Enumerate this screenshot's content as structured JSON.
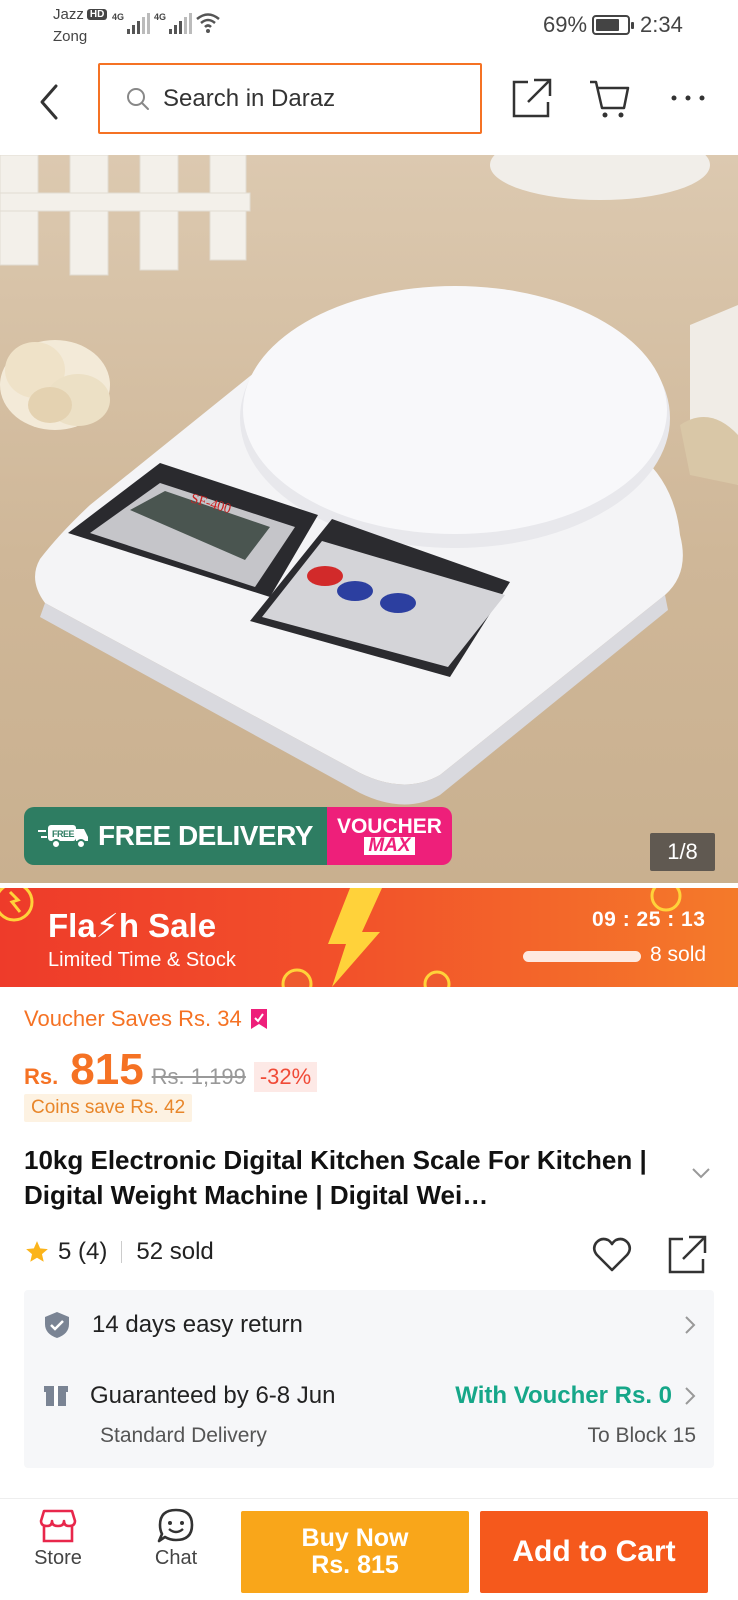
{
  "status_bar": {
    "carrier_primary": "Jazz",
    "hd_badge": "HD",
    "carrier_secondary": "Zong",
    "signal_label": "4G",
    "battery_percent": "69%",
    "battery_level": 0.69,
    "time": "2:34"
  },
  "header": {
    "back_icon": "chevron-left-icon",
    "search_placeholder": "Search in Daraz",
    "share_icon": "share-icon",
    "cart_icon": "cart-icon",
    "more_icon": "more-horizontal-icon"
  },
  "gallery": {
    "promo_free_badge": "FREE",
    "promo_free_delivery": "FREE DELIVERY",
    "promo_voucher": "VOUCHER",
    "promo_max": "MAX",
    "scale_model_label": "SF-400",
    "image_counter": "1/8"
  },
  "flash_sale": {
    "title": "Fla⚡h Sale",
    "subtitle": "Limited Time & Stock",
    "countdown": "09 : 25 : 13",
    "sold_text": "8 sold"
  },
  "pricing": {
    "voucher_saves": "Voucher Saves Rs. 34",
    "currency": "Rs.",
    "price": "815",
    "original_price": "Rs. 1,199",
    "discount": "-32%",
    "coins_save": "Coins save Rs. 42"
  },
  "product": {
    "title": "10kg Electronic Digital Kitchen Scale For Kitchen | Digital Weight Machine | Digital Wei…",
    "rating": "5 (4)",
    "sold": "52 sold"
  },
  "service": {
    "return_policy": "14 days easy return",
    "guarantee": "Guaranteed by 6-8 Jun",
    "delivery_type": "Standard Delivery",
    "voucher_delivery": "With Voucher Rs. 0",
    "destination": "To Block 15"
  },
  "bottom_bar": {
    "store_label": "Store",
    "chat_label": "Chat",
    "buy_now_label": "Buy Now",
    "buy_now_price": "Rs. 815",
    "add_to_cart_label": "Add to Cart"
  },
  "colors": {
    "brand_orange": "#f57224",
    "buy_now": "#f9a61a",
    "add_to_cart": "#f5591c",
    "voucher_green": "#16a789",
    "free_delivery_green": "#2e7d62",
    "voucher_max_pink": "#ee1f7a"
  }
}
